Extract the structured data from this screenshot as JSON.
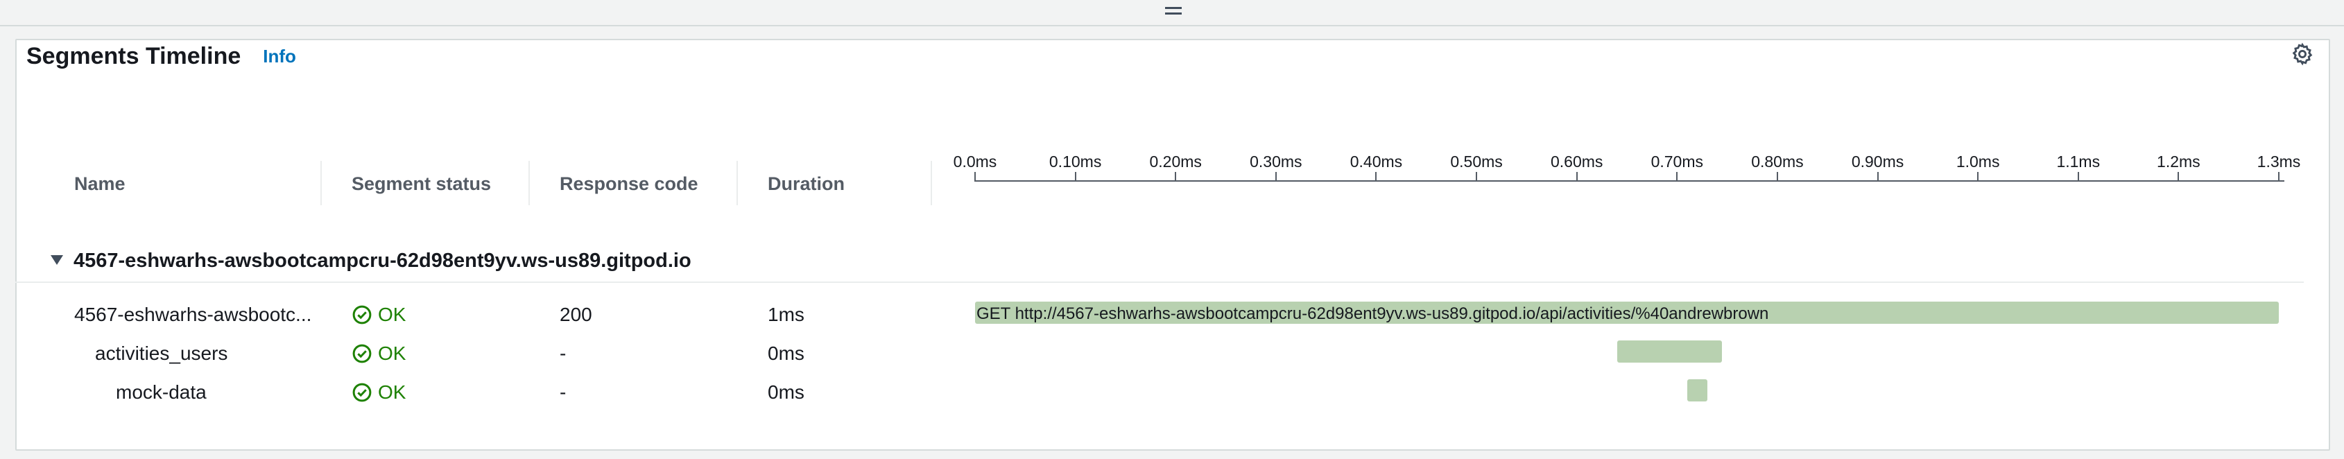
{
  "panel": {
    "title": "Segments Timeline",
    "info_link": "Info"
  },
  "columns": {
    "name": "Name",
    "segment_status": "Segment status",
    "response_code": "Response code",
    "duration": "Duration"
  },
  "timeline_axis": {
    "ticks": [
      "0.0ms",
      "0.10ms",
      "0.20ms",
      "0.30ms",
      "0.40ms",
      "0.50ms",
      "0.60ms",
      "0.70ms",
      "0.80ms",
      "0.90ms",
      "1.0ms",
      "1.1ms",
      "1.2ms",
      "1.3ms"
    ],
    "range_ms": [
      0,
      1.3
    ]
  },
  "group": {
    "label": "4567-eshwarhs-awsbootcampcru-62d98ent9yv.ws-us89.gitpod.io",
    "expanded": true
  },
  "rows": [
    {
      "name": "4567-eshwarhs-awsbootc...",
      "status": "OK",
      "response_code": "200",
      "duration": "1ms",
      "bar_label": "GET http://4567-eshwarhs-awsbootcampcru-62d98ent9yv.ws-us89.gitpod.io/api/activities/%40andrewbrown",
      "start_ms": 0,
      "end_ms": 1.3,
      "indent": 0
    },
    {
      "name": "activities_users",
      "status": "OK",
      "response_code": "-",
      "duration": "0ms",
      "bar_label": "",
      "start_ms": 0.64,
      "end_ms": 0.745,
      "indent": 1
    },
    {
      "name": "mock-data",
      "status": "OK",
      "response_code": "-",
      "duration": "0ms",
      "bar_label": "",
      "start_ms": 0.71,
      "end_ms": 0.73,
      "indent": 2
    }
  ],
  "colors": {
    "bar": "#b8d1b0",
    "status_ok": "#1d8102",
    "info_link": "#0073bb"
  },
  "icons": {
    "status": "check-circle-icon",
    "settings": "gear-icon",
    "group_toggle": "caret-down-icon",
    "panel_resize": "drag-handle-icon"
  }
}
